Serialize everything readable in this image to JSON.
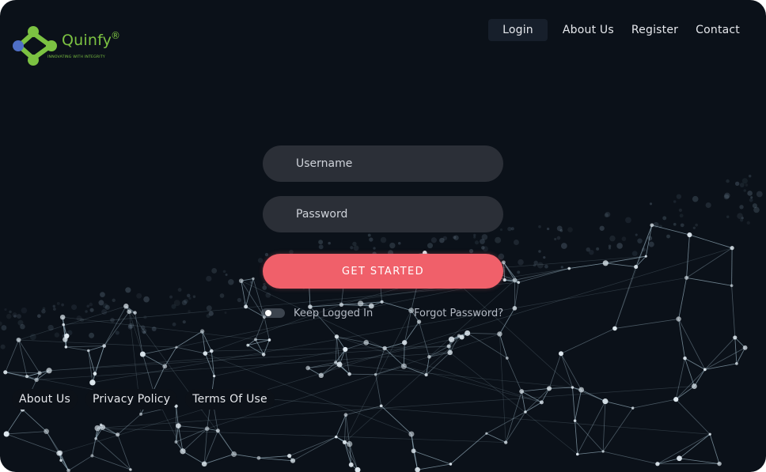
{
  "brand": {
    "name": "Quinfy",
    "registered": "®",
    "tagline": "INNOVATING WITH INTEGRITY",
    "accent": "#7cc242",
    "node_color": "#4f6fc6"
  },
  "nav": {
    "items": [
      {
        "label": "Login",
        "active": true
      },
      {
        "label": "About Us",
        "active": false
      },
      {
        "label": "Register",
        "active": false
      },
      {
        "label": "Contact",
        "active": false
      }
    ]
  },
  "form": {
    "username_placeholder": "Username",
    "password_placeholder": "Password",
    "submit_label": "GET STARTED",
    "keep_logged_in_label": "Keep Logged In",
    "keep_logged_in_checked": false,
    "forgot_label": "Forgot Password?"
  },
  "footer": {
    "links": [
      {
        "label": "About Us"
      },
      {
        "label": "Privacy Policy"
      },
      {
        "label": "Terms Of Use"
      }
    ]
  },
  "colors": {
    "background": "#0b1119",
    "field": "#2b2f37",
    "button": "#f0606a",
    "network": "#9fb4c4"
  }
}
